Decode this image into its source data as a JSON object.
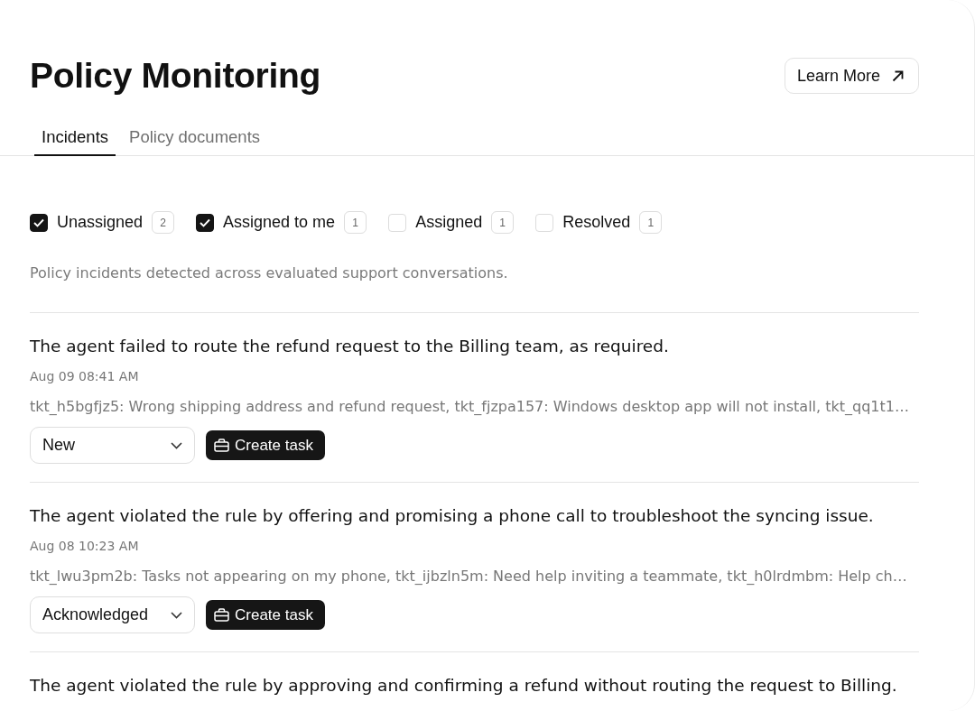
{
  "header": {
    "title": "Policy Monitoring",
    "learn_more": "Learn More"
  },
  "tabs": [
    {
      "label": "Incidents",
      "selected": true
    },
    {
      "label": "Policy documents",
      "selected": false
    }
  ],
  "filters": [
    {
      "label": "Unassigned",
      "checked": true,
      "count": "2"
    },
    {
      "label": "Assigned to me",
      "checked": true,
      "count": "1"
    },
    {
      "label": "Assigned",
      "checked": false,
      "count": "1"
    },
    {
      "label": "Resolved",
      "checked": false,
      "count": "1"
    }
  ],
  "description": "Policy incidents detected across evaluated support conversations.",
  "incidents": [
    {
      "title": "The agent failed to route the refund request to the Billing team, as required.",
      "date": "Aug 09 08:41 AM",
      "tickets": "tkt_h5bgfjz5: Wrong shipping address and refund request, tkt_fjzpa157: Windows desktop app will not install, tkt_qq1t1…",
      "status": "New",
      "action": "Create task"
    },
    {
      "title": "The agent violated the rule by offering and promising a phone call to troubleshoot the syncing issue.",
      "date": "Aug 08 10:23 AM",
      "tickets": "tkt_lwu3pm2b: Tasks not appearing on my phone, tkt_ijbzln5m: Need help inviting a teammate, tkt_h0lrdmbm: Help ch…",
      "status": "Acknowledged",
      "action": "Create task"
    },
    {
      "title": "The agent violated the rule by approving and confirming a refund without routing the request to Billing."
    }
  ]
}
